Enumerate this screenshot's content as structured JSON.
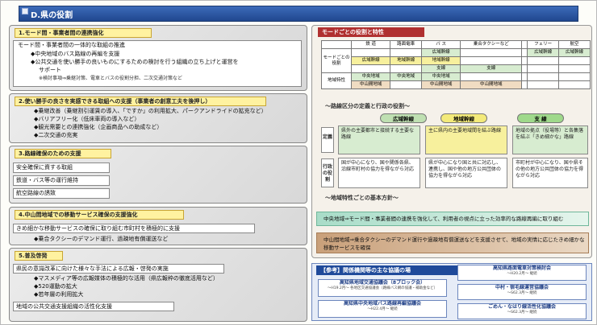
{
  "header": {
    "title": "D.県の役割"
  },
  "sections": [
    {
      "title": "1.モード間・事業者間の連携強化",
      "lines": [
        "モード間・事業者間の一体的な取組の推進",
        "◆中央地域のバス路線の再編を支援",
        "◆公共交通を使い勝手の良いものにするための検討を行う組織の立ち上げと運営を",
        "サポート",
        "※検討事項⇒乗継対策、電車とバスの役割分担、二次交通対策など"
      ]
    },
    {
      "title": "2.使い勝手の良さを実感できる取組への支援（事業者の創意工夫を後押し）",
      "lines": [
        "◆乗継改善（乗継割引運賃の導入、「ですか」の利用拡大、パークアンドライドの拡充など）",
        "◆バリアフリー化（低床車両の導入など）",
        "◆観光需要との連携強化（企画商品への助成など）",
        "◆二次交通の充実"
      ]
    },
    {
      "title": "3.路線確保のための支援",
      "lines": [
        "安全確保に資する取組",
        "鉄道・バス等の運行維持",
        "航空路線の誘致"
      ]
    },
    {
      "title": "4.中山間地域での移動サービス確保の支援強化",
      "lines": [
        "きめ細かな移動サービスの確保に取り組む市町村を積極的に支援",
        "◆乗合タクシーのデマンド運行、過疎地有償運送など"
      ]
    },
    {
      "title": "5.普及啓発",
      "lines": [
        "県民の意識改革に向けた様々な手法による広報・啓発の実施",
        "◆マスメディア等の広報媒体の積極的な活用（県広報枠の徹底活用など）",
        "◆520運動の拡大",
        "◆若年層の利用拡大",
        "地域の公共交通支援組織の活性化支援"
      ]
    }
  ],
  "right": {
    "title": "モードごとの役割と特性",
    "table": {
      "headers": [
        "鉄 道",
        "路面電車",
        "バ ス",
        "乗合タクシーなど",
        "フェリー",
        "航空"
      ],
      "row_label_1": "モードごとの役割",
      "row_label_2": "地域特性",
      "r1": [
        "",
        "",
        "広域幹線",
        "",
        "広域幹線",
        "広域幹線"
      ],
      "r2": [
        "広域幹線",
        "地域幹線",
        "地域幹線",
        "",
        "",
        ""
      ],
      "r3": [
        "",
        "",
        "支線",
        "支線",
        "",
        ""
      ],
      "r4": [
        "中央地域",
        "中央地域",
        "中央地域",
        "",
        "",
        ""
      ],
      "r5": [
        "中山間地域",
        "",
        "中山間地域",
        "中山間地域",
        "",
        ""
      ]
    },
    "def_heading": "〜路線区分の定義と行政の役割〜",
    "ovals": [
      "広域幹線",
      "地域幹線",
      "支 線"
    ],
    "def_label": "定義",
    "admin_label": "行政の役割",
    "defs": [
      "県外の主要都市と接続する主要な路線",
      "主に県内の主要地域間を結ぶ路線",
      "地域の拠点（役場等）と各集落を結ぶ「きめ細かな」路線"
    ],
    "roles": [
      "国が中心になり、国や関係各県、沿線市町村の協力を得ながら対応",
      "県が中心になり国と共に対応し、連携し、国や他の地方公共団体の協力を得ながら対応",
      "市町村が中心になり、国や県その他の地方公共団体の協力を得ながら対応"
    ],
    "policy_heading": "〜地域特性ごとの基本方針〜",
    "policy_central": "中央地域⇒モード間・事業者間の連携を強化して、利用者の視点に立った効率的な路線再編に取り組む",
    "policy_mountain": "中山間地域⇒乗合タクシーのデマンド運行や過疎地有償運送などを支援させて、地域の実情に応じたきめ細かな移動サービスを確保"
  },
  "councils": {
    "title": "【参考】関係機関等の主な協議の場",
    "items": [
      {
        "name": "高知県地域交通協議会（8ブロック会）",
        "desc": "〜H19.2月〜 各地区交通協議会（路線バス網の協議・補助金など）"
      },
      {
        "name": "高知県路面電車対策検討会",
        "desc": "〜H20.2月〜 継続"
      },
      {
        "name": "高知県中央地域バス路線再編協議会",
        "desc": "〜H22.4月〜 継続"
      },
      {
        "name": "中村・宿毛線運営協議会",
        "desc": "〜S62.3月〜 継続"
      },
      {
        "name": "ごめん・なはり線活性化協議会",
        "desc": "〜S62.3月〜 継続"
      }
    ]
  },
  "colors": {
    "header": "#2a55a3",
    "section_title": "#fff2a0",
    "green": "#d7ecd0",
    "yellow": "#f7f09d",
    "tan": "#f0dcc2",
    "red": "#b03030",
    "navy": "#1f4a9a"
  }
}
